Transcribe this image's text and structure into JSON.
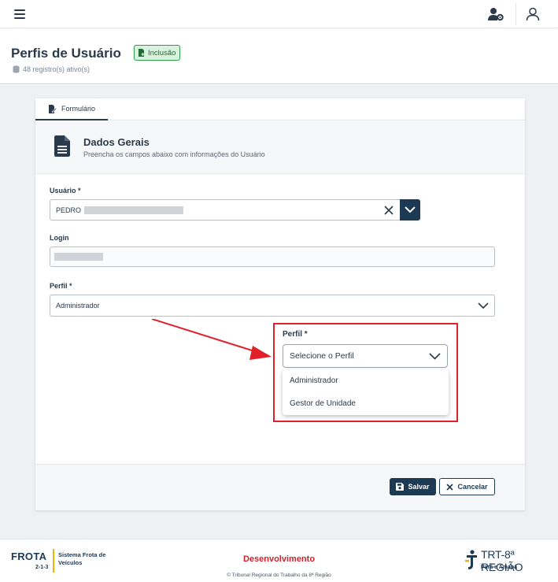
{
  "topbar": {
    "menu_icon": "hamburger-icon",
    "user_gear_icon": "user-gear-icon",
    "user_icon": "user-icon"
  },
  "header": {
    "title": "Perfis de Usuário",
    "badge": "Inclusão",
    "records": "48 registro(s) ativo(s)"
  },
  "tabs": [
    {
      "label": "Formulário"
    }
  ],
  "section": {
    "title": "Dados Gerais",
    "subtitle": "Preencha os campos abaixo com informações do Usuário"
  },
  "form": {
    "usuario_label": "Usuário *",
    "usuario_value": "PEDRO",
    "login_label": "Login",
    "perfil_label": "Perfil *",
    "perfil_value": "Administrador"
  },
  "callout": {
    "label": "Perfil *",
    "placeholder": "Selecione o Perfil",
    "options": [
      "Administrador",
      "Gestor de Unidade"
    ]
  },
  "actions": {
    "save": "Salvar",
    "cancel": "Cancelar"
  },
  "footer": {
    "logo": "FROTA",
    "version": "2-1-3",
    "system_name": "Sistema Frota de Veículos",
    "environment": "Desenvolvimento",
    "copyright": "© Tribunal Regional do Trabalho da 8ª Região",
    "org_name": "TRT-8ª REGIÃO",
    "org_sub": "Pará e Amapá"
  },
  "colors": {
    "primary": "#1d3a55",
    "highlight": "#e2202a",
    "badge_bg": "#d9f2df",
    "environment": "#d0202a"
  }
}
